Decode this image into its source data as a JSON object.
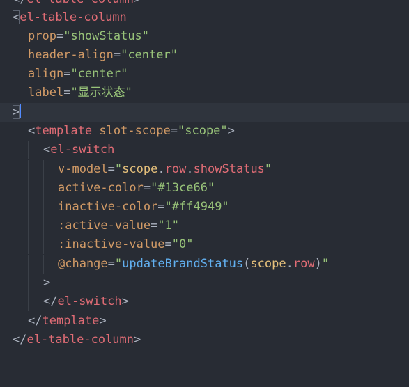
{
  "colors": {
    "background": "#282c34",
    "tag": "#e06c75",
    "attribute": "#d19a66",
    "string": "#98c379",
    "variable": "#e5c07b",
    "function": "#61afef",
    "punctuation": "#abb2bf"
  },
  "code": {
    "l0": {
      "close_open": "</",
      "tag": "el-table-column",
      "close": ">"
    },
    "l1": {
      "open": "<",
      "tag": "el-table-column"
    },
    "l2": {
      "attr": "prop",
      "eq": "=",
      "value": "\"showStatus\""
    },
    "l3": {
      "attr": "header-align",
      "eq": "=",
      "value": "\"center\""
    },
    "l4": {
      "attr": "align",
      "eq": "=",
      "value": "\"center\""
    },
    "l5": {
      "attr": "label",
      "eq": "=",
      "value": "\"显示状态\""
    },
    "l6": {
      "close": ">"
    },
    "l7": {
      "open": "<",
      "tag": "template",
      "attr": "slot-scope",
      "eq": "=",
      "value": "\"scope\"",
      "close": ">"
    },
    "l8": {
      "open": "<",
      "tag": "el-switch"
    },
    "l9": {
      "attr": "v-model",
      "eq": "=",
      "q1": "\"",
      "var": "scope",
      "dot1": ".",
      "p1": "row",
      "dot2": ".",
      "p2": "showStatus",
      "q2": "\""
    },
    "l10": {
      "attr": "active-color",
      "eq": "=",
      "value": "\"#13ce66\""
    },
    "l11": {
      "attr": "inactive-color",
      "eq": "=",
      "value": "\"#ff4949\""
    },
    "l12": {
      "attr": ":active-value",
      "eq": "=",
      "value": "\"1\""
    },
    "l13": {
      "attr": ":inactive-value",
      "eq": "=",
      "value": "\"0\""
    },
    "l14": {
      "attr": "@change",
      "eq": "=",
      "q1": "\"",
      "fn": "updateBrandStatus",
      "paren1": "(",
      "var": "scope",
      "dot": ".",
      "prop": "row",
      "paren2": ")",
      "q2": "\""
    },
    "l15": {
      "close": ">"
    },
    "l16": {
      "close_open": "</",
      "tag": "el-switch",
      "close": ">"
    },
    "l17": {
      "close_open": "</",
      "tag": "template",
      "close": ">"
    },
    "l18": {
      "close_open": "</",
      "tag": "el-table-column",
      "close": ">"
    }
  }
}
